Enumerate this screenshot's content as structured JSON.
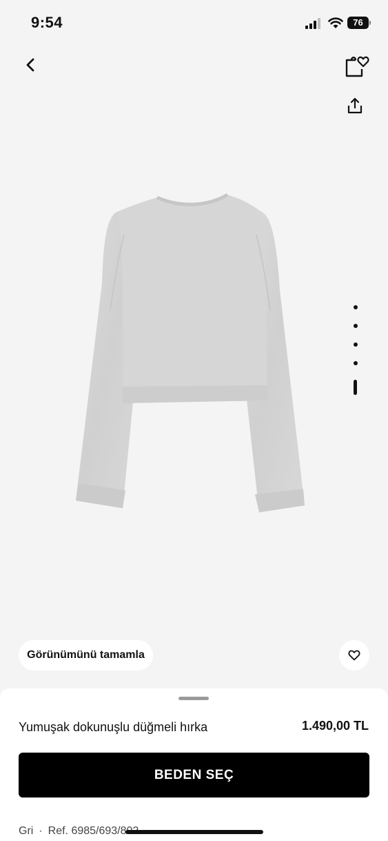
{
  "status_bar": {
    "time": "9:54",
    "battery_level": "76",
    "icons": [
      "signal-icon",
      "wifi-icon",
      "battery-icon"
    ]
  },
  "header": {
    "icons": [
      "chevron-left-icon",
      "wishlist-bag-heart-icon",
      "share-icon"
    ]
  },
  "gallery": {
    "image": "grey-cropped-cardigan-back-view",
    "page_count": 5,
    "active_page": 5
  },
  "actions": {
    "complete_look_label": "Görünümünü tamamla",
    "favorite_icon": "heart-icon"
  },
  "product": {
    "name": "Yumuşak dokunuşlu düğmeli hırka",
    "price": "1.490,00 TL",
    "color": "Gri",
    "separator": "·",
    "reference": "Ref. 6985/693/802"
  },
  "cta": {
    "label": "BEDEN SEÇ"
  },
  "colors": {
    "background": "#f4f4f4",
    "cta_background": "#000000",
    "garment": "#d3d3d3"
  }
}
